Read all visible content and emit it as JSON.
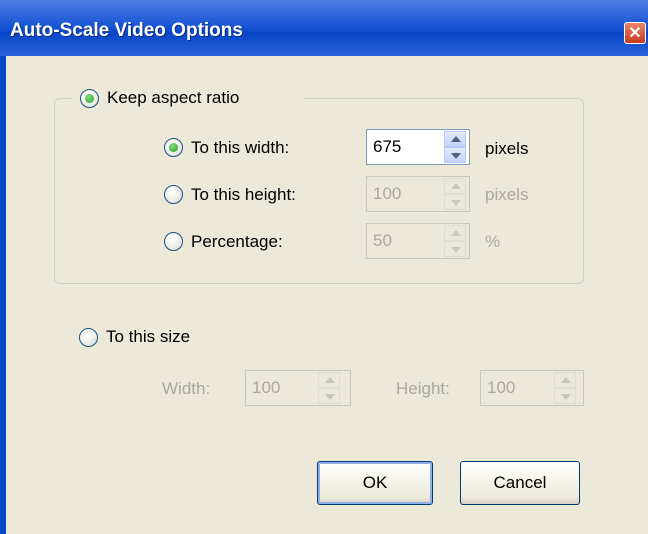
{
  "window": {
    "title": "Auto-Scale Video Options",
    "close_glyph": "✕"
  },
  "keep_aspect": {
    "label": "Keep aspect ratio",
    "checked": true,
    "width": {
      "label": "To this width:",
      "checked": true,
      "value": "675",
      "unit": "pixels"
    },
    "height": {
      "label": "To this height:",
      "checked": false,
      "value": "100",
      "unit": "pixels"
    },
    "percentage": {
      "label": "Percentage:",
      "checked": false,
      "value": "50",
      "unit": "%"
    }
  },
  "to_size": {
    "label": "To this size",
    "checked": false,
    "width_label": "Width:",
    "width_value": "100",
    "height_label": "Height:",
    "height_value": "100"
  },
  "buttons": {
    "ok": "OK",
    "cancel": "Cancel"
  },
  "colors": {
    "title_bar": "#0a46c8",
    "face": "#ece9d8",
    "radio_dot": "#21a121",
    "disabled_text": "#aca899"
  }
}
